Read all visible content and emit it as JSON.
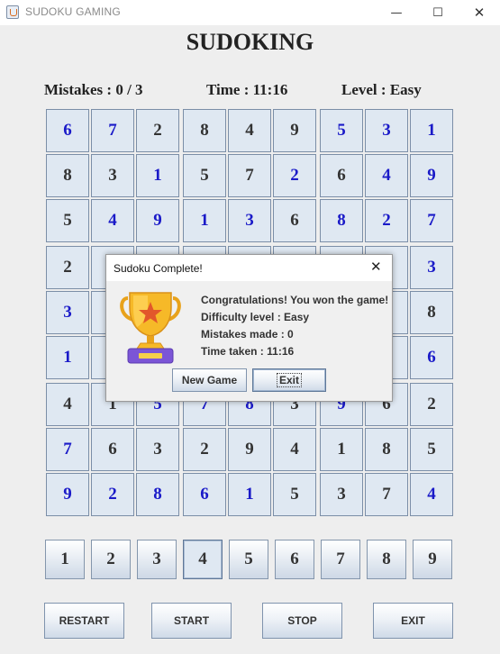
{
  "window": {
    "title": "SUDOKU GAMING",
    "controls": {
      "minimize": "—",
      "maximize": "☐",
      "close": "✕"
    }
  },
  "heading": "SUDOKING",
  "stats": {
    "mistakes": "Mistakes : 0 / 3",
    "time": "Time : 11:16",
    "level": "Level : Easy"
  },
  "grid": {
    "rows": [
      [
        "6",
        "7",
        "2",
        "8",
        "4",
        "9",
        "5",
        "3",
        "1"
      ],
      [
        "8",
        "3",
        "1",
        "5",
        "7",
        "2",
        "6",
        "4",
        "9"
      ],
      [
        "5",
        "4",
        "9",
        "1",
        "3",
        "6",
        "8",
        "2",
        "7"
      ],
      [
        "2",
        "",
        "",
        "",
        "",
        "",
        "",
        "",
        "3"
      ],
      [
        "3",
        "",
        "",
        "",
        "",
        "",
        "",
        "",
        "8"
      ],
      [
        "1",
        "",
        "",
        "",
        "",
        "",
        "",
        "",
        "6"
      ],
      [
        "4",
        "1",
        "5",
        "7",
        "8",
        "3",
        "9",
        "6",
        "2"
      ],
      [
        "7",
        "6",
        "3",
        "2",
        "9",
        "4",
        "1",
        "8",
        "5"
      ],
      [
        "9",
        "2",
        "8",
        "6",
        "1",
        "5",
        "3",
        "7",
        "4"
      ]
    ],
    "colors": {
      "given": "#333333",
      "user": "#1a1ac8",
      "rows": [
        [
          "u",
          "u",
          "g",
          "g",
          "g",
          "g",
          "u",
          "u",
          "u"
        ],
        [
          "g",
          "g",
          "u",
          "g",
          "g",
          "u",
          "g",
          "u",
          "u"
        ],
        [
          "g",
          "u",
          "u",
          "u",
          "u",
          "g",
          "u",
          "u",
          "u"
        ],
        [
          "g",
          "g",
          "g",
          "g",
          "g",
          "g",
          "g",
          "g",
          "u"
        ],
        [
          "u",
          "g",
          "g",
          "g",
          "g",
          "g",
          "g",
          "g",
          "g"
        ],
        [
          "u",
          "g",
          "g",
          "g",
          "g",
          "g",
          "g",
          "g",
          "u"
        ],
        [
          "g",
          "g",
          "u",
          "u",
          "u",
          "g",
          "u",
          "g",
          "g"
        ],
        [
          "u",
          "g",
          "g",
          "g",
          "g",
          "g",
          "g",
          "g",
          "g"
        ],
        [
          "u",
          "u",
          "u",
          "u",
          "u",
          "g",
          "g",
          "g",
          "u"
        ]
      ]
    }
  },
  "number_pad": {
    "labels": [
      "1",
      "2",
      "3",
      "4",
      "5",
      "6",
      "7",
      "8",
      "9"
    ],
    "selected": "4"
  },
  "actions": {
    "restart": "RESTART",
    "start": "START",
    "stop": "STOP",
    "exit": "EXIT"
  },
  "dialog": {
    "title": "Sudoku Complete!",
    "close": "✕",
    "icon": "trophy-icon",
    "lines": [
      "Congratulations! You won the game!",
      "Difficulty level : Easy",
      "Mistakes made : 0",
      "Time taken : 11:16"
    ],
    "new_game_label": "New Game",
    "exit_label": "Exit"
  }
}
